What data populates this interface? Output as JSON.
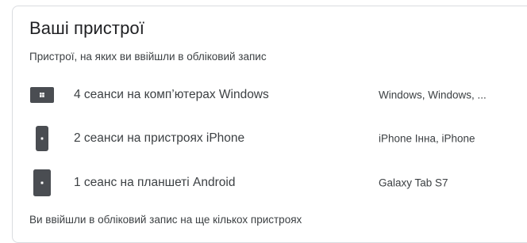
{
  "card": {
    "title": "Ваші пристрої",
    "subtitle": "Пристрої, на яких ви ввійшли в обліковий запис",
    "devices": [
      {
        "icon": "windows-computer-icon",
        "label": "4 сеанси на комп’ютерах Windows",
        "detail": "Windows, Windows, ..."
      },
      {
        "icon": "iphone-icon",
        "label": "2 сеанси на пристроях iPhone",
        "detail": "iPhone Інна, iPhone"
      },
      {
        "icon": "android-tablet-icon",
        "label": "1 сеанс на планшеті Android",
        "detail": "Galaxy Tab S7"
      }
    ],
    "footer": "Ви ввійшли в обліковий запис на ще кількох пристроях"
  },
  "colors": {
    "icon_fill": "#4a4d52",
    "text": "#3c4043",
    "border": "#dadce0"
  }
}
